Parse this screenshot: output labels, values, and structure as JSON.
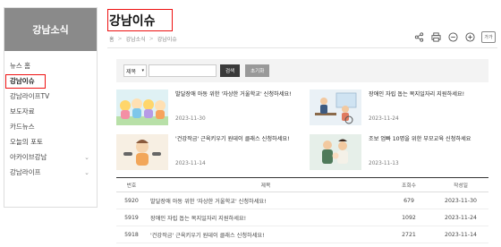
{
  "sidebar": {
    "title": "강남소식",
    "items": [
      {
        "label": "뉴스 홈",
        "chevron": false
      },
      {
        "label": "강남이슈",
        "chevron": false
      },
      {
        "label": "강남라이프TV",
        "chevron": false
      },
      {
        "label": "보도자료",
        "chevron": false
      },
      {
        "label": "카드뉴스",
        "chevron": false
      },
      {
        "label": "오늘의 포토",
        "chevron": false
      },
      {
        "label": "아카이브강남",
        "chevron": true
      },
      {
        "label": "강남라이프",
        "chevron": true
      }
    ]
  },
  "page": {
    "title": "강남이슈",
    "breadcrumb": [
      "홈",
      "강남소식",
      "강남이슈"
    ],
    "tools": {
      "share": "share-icon",
      "print": "print-icon",
      "zoom_out": "zoom-out-icon",
      "zoom_in": "zoom-in-icon",
      "text_size": "가가"
    }
  },
  "search": {
    "select_value": "제목",
    "input_value": "",
    "search_label": "검색",
    "reset_label": "초기화"
  },
  "cards": [
    {
      "title": "발달장애 아동 위한 '자상한 거울학교' 신청하세요!",
      "date": "2023-11-30"
    },
    {
      "title": "장애인 자립 돕는 복지일자리 지원하세요!",
      "date": "2023-11-24"
    },
    {
      "title": "'건강작금' 근육키우기 원데이 클래스 신청하세요!",
      "date": "2023-11-14"
    },
    {
      "title": "조보 엄빠 10명을 위한 부모교육 신청하세요",
      "date": "2023-11-13"
    }
  ],
  "table": {
    "headers": {
      "no": "번호",
      "title": "제목",
      "views": "조회수",
      "date": "작성일"
    },
    "rows": [
      {
        "no": "5920",
        "title": "발달장애 아동 위한 '자상한 거울학교' 신청하세요!",
        "views": "679",
        "date": "2023-11-30"
      },
      {
        "no": "5919",
        "title": "장애인 자립 돕는 복지일자리 지원하세요!",
        "views": "1092",
        "date": "2023-11-24"
      },
      {
        "no": "5918",
        "title": "'건강작금' 근육키우기 원데이 클래스 신청하세요!",
        "views": "2721",
        "date": "2023-11-14"
      }
    ]
  }
}
